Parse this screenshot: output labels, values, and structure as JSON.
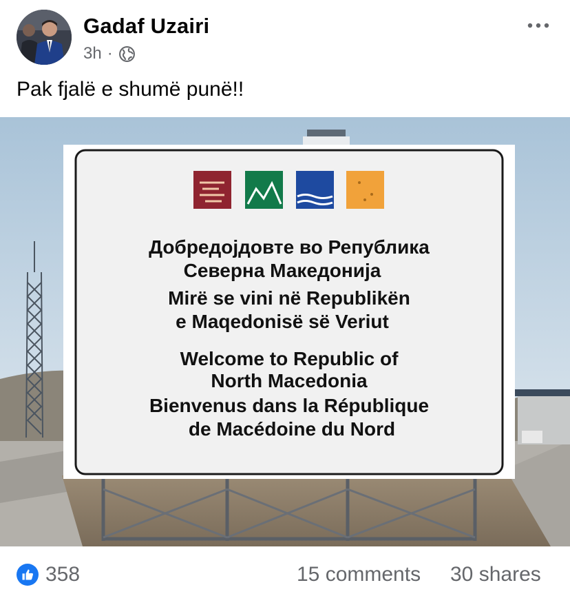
{
  "post": {
    "author": "Gadaf Uzairi",
    "time": "3h",
    "separator": "·",
    "audience_icon": "globe-icon",
    "menu_icon": "more-options-icon",
    "caption": "Pak fjalë e shumë punë!!"
  },
  "photo": {
    "sign": {
      "lines_mk": [
        "Добредојдовте во Република",
        "Северна Македонија"
      ],
      "lines_sq": [
        "Mirë se vini në Republikën",
        "e Maqedonisë së Veriut"
      ],
      "lines_en": [
        "Welcome to Republic of",
        "North Macedonia"
      ],
      "lines_fr": [
        "Bienvenus dans la République",
        "de Macédoine du Nord"
      ]
    },
    "colors": {
      "sky": "#b9cfe0",
      "sign_bg": "#f1f1f1",
      "tile_red": "#8f2430",
      "tile_green": "#127a4a",
      "tile_blue": "#1e4aa0",
      "tile_orange": "#f1a23a"
    }
  },
  "reactions": {
    "icon": "like-icon",
    "count": "358",
    "comments": "15 comments",
    "shares": "30 shares",
    "accent": "#1877f2"
  }
}
